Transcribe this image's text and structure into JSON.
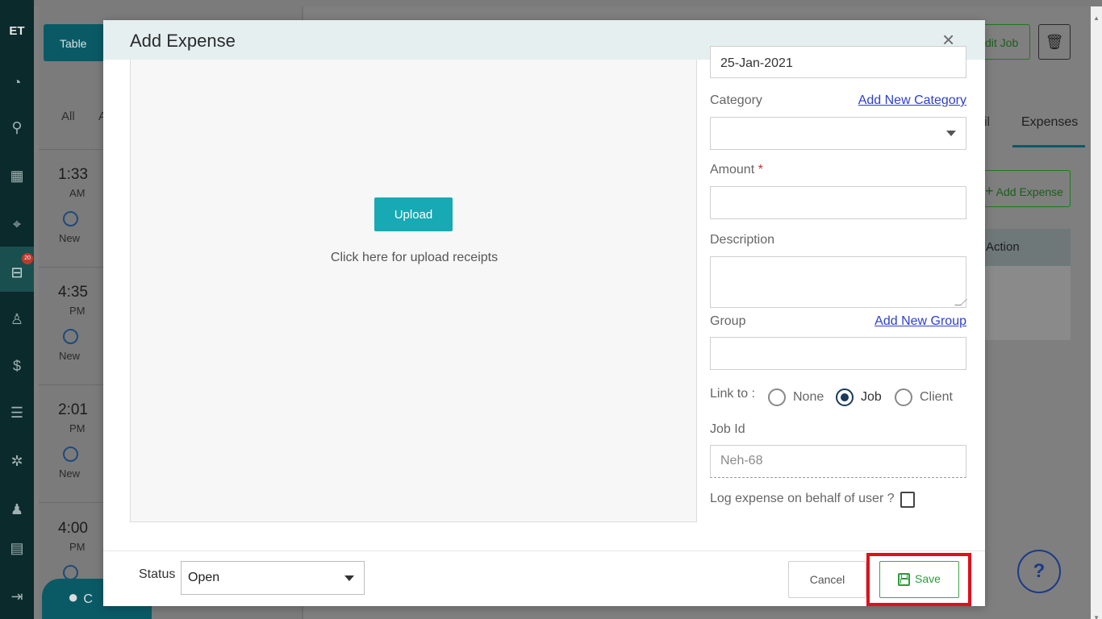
{
  "background_app": {
    "logo": "ET",
    "notification_badge": "20",
    "table_button_label": "Table",
    "filters": {
      "all": "All",
      "a": "A"
    },
    "schedule": [
      {
        "time": "1:33",
        "ampm": "AM",
        "status": "New"
      },
      {
        "time": "4:35",
        "ampm": "PM",
        "status": "New"
      },
      {
        "time": "2:01",
        "ampm": "PM",
        "status": "New"
      },
      {
        "time": "4:00",
        "ampm": "PM",
        "status": ""
      }
    ],
    "edit_job_label": "dit Job",
    "tabs": {
      "partial": "il",
      "expenses": "Expenses"
    },
    "add_expense_label": "Add Expense",
    "table_header_action": "Action",
    "help_label": "?",
    "chat_label": "C"
  },
  "modal": {
    "title": "Add Expense",
    "close_symbol": "×",
    "upload": {
      "button_label": "Upload",
      "hint": "Click here for upload receipts"
    },
    "form": {
      "date_value": "25-Jan-2021",
      "category_label": "Category",
      "add_category_link": "Add New Category",
      "category_value": "",
      "amount_label": "Amount",
      "required_marker": "*",
      "amount_value": "",
      "description_label": "Description",
      "group_label": "Group",
      "add_group_link": "Add New Group",
      "link_to_label": "Link to :",
      "link_options": [
        "None",
        "Job",
        "Client"
      ],
      "selected_link": "Job",
      "job_id_label": "Job Id",
      "job_id_placeholder": "Neh-68",
      "behalf_label": "Log expense on behalf of user ?"
    },
    "footer": {
      "status_label": "Status",
      "status_value": "Open",
      "cancel_label": "Cancel",
      "save_label": "Save"
    }
  },
  "colors": {
    "accent_teal": "#17a9b4",
    "save_green": "#2c9a3c",
    "link_blue": "#2f3fcf",
    "highlight_red": "#e0101a",
    "sidebar_dark": "#0b2a2b"
  },
  "icons": {
    "sidebar": [
      "dashboard-icon",
      "funnel-icon",
      "calendar-icon",
      "map-pin-icon",
      "briefcase-icon",
      "user-icon",
      "dollar-icon",
      "list-icon",
      "handshake-icon",
      "team-icon",
      "settings-list-icon",
      "logout-icon"
    ]
  }
}
